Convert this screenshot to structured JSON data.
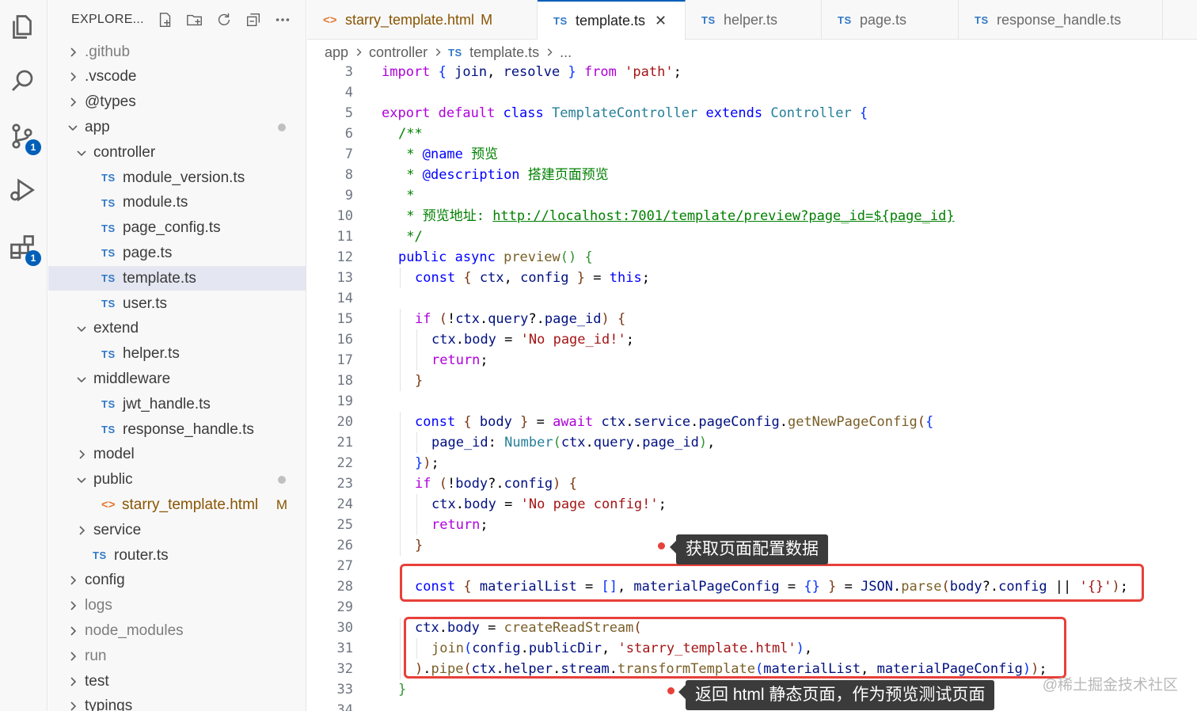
{
  "activity": {
    "scm_badge": "1",
    "extensions_badge": "1"
  },
  "sidebar": {
    "title": "EXPLORE...",
    "tree": [
      {
        "label": ".github",
        "kind": "folder",
        "open": false,
        "depth": 0,
        "dim": true
      },
      {
        "label": ".vscode",
        "kind": "folder",
        "open": false,
        "depth": 0
      },
      {
        "label": "@types",
        "kind": "folder",
        "open": false,
        "depth": 0
      },
      {
        "label": "app",
        "kind": "folder",
        "open": true,
        "depth": 0,
        "git": "modified-dot"
      },
      {
        "label": "controller",
        "kind": "folder",
        "open": true,
        "depth": 1
      },
      {
        "label": "module_version.ts",
        "kind": "ts",
        "depth": 2
      },
      {
        "label": "module.ts",
        "kind": "ts",
        "depth": 2
      },
      {
        "label": "page_config.ts",
        "kind": "ts",
        "depth": 2
      },
      {
        "label": "page.ts",
        "kind": "ts",
        "depth": 2
      },
      {
        "label": "template.ts",
        "kind": "ts",
        "depth": 2,
        "selected": true
      },
      {
        "label": "user.ts",
        "kind": "ts",
        "depth": 2
      },
      {
        "label": "extend",
        "kind": "folder",
        "open": true,
        "depth": 1
      },
      {
        "label": "helper.ts",
        "kind": "ts",
        "depth": 2
      },
      {
        "label": "middleware",
        "kind": "folder",
        "open": true,
        "depth": 1
      },
      {
        "label": "jwt_handle.ts",
        "kind": "ts",
        "depth": 2
      },
      {
        "label": "response_handle.ts",
        "kind": "ts",
        "depth": 2
      },
      {
        "label": "model",
        "kind": "folder",
        "open": false,
        "depth": 1
      },
      {
        "label": "public",
        "kind": "folder",
        "open": true,
        "depth": 1,
        "git": "modified-dot"
      },
      {
        "label": "starry_template.html",
        "kind": "html",
        "depth": 2,
        "git": "M"
      },
      {
        "label": "service",
        "kind": "folder",
        "open": false,
        "depth": 1
      },
      {
        "label": "router.ts",
        "kind": "ts",
        "depth": 1
      },
      {
        "label": "config",
        "kind": "folder",
        "open": false,
        "depth": 0
      },
      {
        "label": "logs",
        "kind": "folder",
        "open": false,
        "depth": 0,
        "dim": true
      },
      {
        "label": "node_modules",
        "kind": "folder",
        "open": false,
        "depth": 0,
        "dim": true
      },
      {
        "label": "run",
        "kind": "folder",
        "open": false,
        "depth": 0,
        "dim": true
      },
      {
        "label": "test",
        "kind": "folder",
        "open": false,
        "depth": 0
      },
      {
        "label": "typings",
        "kind": "folder",
        "open": false,
        "depth": 0
      }
    ]
  },
  "tabs": [
    {
      "label": "starry_template.html",
      "kind": "html",
      "flag": "M",
      "active": false
    },
    {
      "label": "template.ts",
      "kind": "ts",
      "active": true,
      "close": "✕"
    },
    {
      "label": "helper.ts",
      "kind": "ts",
      "active": false
    },
    {
      "label": "page.ts",
      "kind": "ts",
      "active": false
    },
    {
      "label": "response_handle.ts",
      "kind": "ts",
      "active": false
    }
  ],
  "file_icons": {
    "ts": "TS",
    "html": "<>"
  },
  "breadcrumb": [
    "app",
    "controller",
    "template.ts",
    "..."
  ],
  "code_lines": [
    {
      "n": "3",
      "indent": 0,
      "tokens": [
        [
          "kc",
          "import "
        ],
        [
          "br1",
          "{ "
        ],
        [
          "var",
          "join"
        ],
        [
          "pl",
          ", "
        ],
        [
          "var",
          "resolve"
        ],
        [
          "br1",
          " }"
        ],
        [
          "kc",
          " from "
        ],
        [
          "str",
          "'path'"
        ],
        [
          "pl",
          ";"
        ]
      ]
    },
    {
      "n": "4",
      "indent": 0,
      "tokens": []
    },
    {
      "n": "5",
      "indent": 0,
      "tokens": [
        [
          "kc",
          "export "
        ],
        [
          "kc",
          "default "
        ],
        [
          "kw",
          "class "
        ],
        [
          "cls",
          "TemplateController "
        ],
        [
          "kw",
          "extends "
        ],
        [
          "cls",
          "Controller "
        ],
        [
          "br1",
          "{"
        ]
      ]
    },
    {
      "n": "6",
      "indent": 1,
      "tokens": [
        [
          "cm",
          "/**"
        ]
      ]
    },
    {
      "n": "7",
      "indent": 1,
      "tokens": [
        [
          "cm",
          " * "
        ],
        [
          "cm-tag",
          "@name"
        ],
        [
          "cm",
          " 预览"
        ]
      ]
    },
    {
      "n": "8",
      "indent": 1,
      "tokens": [
        [
          "cm",
          " * "
        ],
        [
          "cm-tag",
          "@description"
        ],
        [
          "cm",
          " 搭建页面预览"
        ]
      ]
    },
    {
      "n": "9",
      "indent": 1,
      "tokens": [
        [
          "cm",
          " *"
        ]
      ]
    },
    {
      "n": "10",
      "indent": 1,
      "tokens": [
        [
          "cm",
          " * 预览地址: "
        ],
        [
          "lnk",
          "http://localhost:7001/template/preview?page_id=${page_id}"
        ]
      ]
    },
    {
      "n": "11",
      "indent": 1,
      "tokens": [
        [
          "cm",
          " */"
        ]
      ]
    },
    {
      "n": "12",
      "indent": 1,
      "tokens": [
        [
          "kw",
          "public "
        ],
        [
          "kw",
          "async "
        ],
        [
          "fn",
          "preview"
        ],
        [
          "br2",
          "()"
        ],
        [
          "pl",
          " "
        ],
        [
          "br2",
          "{"
        ]
      ]
    },
    {
      "n": "13",
      "indent": 2,
      "tokens": [
        [
          "kw",
          "const "
        ],
        [
          "br3",
          "{ "
        ],
        [
          "var",
          "ctx"
        ],
        [
          "pl",
          ", "
        ],
        [
          "var",
          "config"
        ],
        [
          "br3",
          " }"
        ],
        [
          "pl",
          " = "
        ],
        [
          "kw",
          "this"
        ],
        [
          "pl",
          ";"
        ]
      ]
    },
    {
      "n": "14",
      "indent": 0,
      "tokens": []
    },
    {
      "n": "15",
      "indent": 2,
      "tokens": [
        [
          "kc",
          "if "
        ],
        [
          "br3",
          "("
        ],
        [
          "pl",
          "!"
        ],
        [
          "var",
          "ctx"
        ],
        [
          "pl",
          "."
        ],
        [
          "var",
          "query"
        ],
        [
          "pl",
          "?."
        ],
        [
          "var",
          "page_id"
        ],
        [
          "br3",
          ")"
        ],
        [
          "pl",
          " "
        ],
        [
          "br3",
          "{"
        ]
      ]
    },
    {
      "n": "16",
      "indent": 3,
      "tokens": [
        [
          "var",
          "ctx"
        ],
        [
          "pl",
          "."
        ],
        [
          "var",
          "body"
        ],
        [
          "pl",
          " = "
        ],
        [
          "str",
          "'No page_id!'"
        ],
        [
          "pl",
          ";"
        ]
      ]
    },
    {
      "n": "17",
      "indent": 3,
      "tokens": [
        [
          "kc",
          "return"
        ],
        [
          "pl",
          ";"
        ]
      ]
    },
    {
      "n": "18",
      "indent": 2,
      "tokens": [
        [
          "br3",
          "}"
        ]
      ]
    },
    {
      "n": "19",
      "indent": 0,
      "tokens": []
    },
    {
      "n": "20",
      "indent": 2,
      "tokens": [
        [
          "kw",
          "const "
        ],
        [
          "br3",
          "{ "
        ],
        [
          "var",
          "body"
        ],
        [
          "br3",
          " }"
        ],
        [
          "pl",
          " = "
        ],
        [
          "kc",
          "await "
        ],
        [
          "var",
          "ctx"
        ],
        [
          "pl",
          "."
        ],
        [
          "var",
          "service"
        ],
        [
          "pl",
          "."
        ],
        [
          "var",
          "pageConfig"
        ],
        [
          "pl",
          "."
        ],
        [
          "fn",
          "getNewPageConfig"
        ],
        [
          "br3",
          "("
        ],
        [
          "br1",
          "{"
        ]
      ]
    },
    {
      "n": "21",
      "indent": 3,
      "tokens": [
        [
          "var",
          "page_id"
        ],
        [
          "pl",
          ": "
        ],
        [
          "cls",
          "Number"
        ],
        [
          "br2",
          "("
        ],
        [
          "var",
          "ctx"
        ],
        [
          "pl",
          "."
        ],
        [
          "var",
          "query"
        ],
        [
          "pl",
          "."
        ],
        [
          "var",
          "page_id"
        ],
        [
          "br2",
          ")"
        ],
        [
          "pl",
          ","
        ]
      ]
    },
    {
      "n": "22",
      "indent": 2,
      "tokens": [
        [
          "br1",
          "}"
        ],
        [
          "br3",
          ")"
        ],
        [
          "pl",
          ";"
        ]
      ]
    },
    {
      "n": "23",
      "indent": 2,
      "tokens": [
        [
          "kc",
          "if "
        ],
        [
          "br3",
          "("
        ],
        [
          "pl",
          "!"
        ],
        [
          "var",
          "body"
        ],
        [
          "pl",
          "?."
        ],
        [
          "var",
          "config"
        ],
        [
          "br3",
          ")"
        ],
        [
          "pl",
          " "
        ],
        [
          "br3",
          "{"
        ]
      ]
    },
    {
      "n": "24",
      "indent": 3,
      "tokens": [
        [
          "var",
          "ctx"
        ],
        [
          "pl",
          "."
        ],
        [
          "var",
          "body"
        ],
        [
          "pl",
          " = "
        ],
        [
          "str",
          "'No page config!'"
        ],
        [
          "pl",
          ";"
        ]
      ]
    },
    {
      "n": "25",
      "indent": 3,
      "tokens": [
        [
          "kc",
          "return"
        ],
        [
          "pl",
          ";"
        ]
      ]
    },
    {
      "n": "26",
      "indent": 2,
      "tokens": [
        [
          "br3",
          "}"
        ]
      ]
    },
    {
      "n": "27",
      "indent": 0,
      "tokens": []
    },
    {
      "n": "28",
      "indent": 2,
      "tokens": [
        [
          "kw",
          "const "
        ],
        [
          "br3",
          "{ "
        ],
        [
          "var",
          "materialList"
        ],
        [
          "pl",
          " = "
        ],
        [
          "br1",
          "[]"
        ],
        [
          "pl",
          ", "
        ],
        [
          "var",
          "materialPageConfig"
        ],
        [
          "pl",
          " = "
        ],
        [
          "br1",
          "{}"
        ],
        [
          "br3",
          " }"
        ],
        [
          "pl",
          " = "
        ],
        [
          "var",
          "JSON"
        ],
        [
          "pl",
          "."
        ],
        [
          "fn",
          "parse"
        ],
        [
          "br3",
          "("
        ],
        [
          "var",
          "body"
        ],
        [
          "pl",
          "?."
        ],
        [
          "var",
          "config"
        ],
        [
          "pl",
          " || "
        ],
        [
          "str",
          "'{}'"
        ],
        [
          "br3",
          ")"
        ],
        [
          "pl",
          ";"
        ]
      ]
    },
    {
      "n": "29",
      "indent": 0,
      "tokens": []
    },
    {
      "n": "30",
      "indent": 2,
      "tokens": [
        [
          "var",
          "ctx"
        ],
        [
          "pl",
          "."
        ],
        [
          "var",
          "body"
        ],
        [
          "pl",
          " = "
        ],
        [
          "fn",
          "createReadStream"
        ],
        [
          "br3",
          "("
        ]
      ]
    },
    {
      "n": "31",
      "indent": 3,
      "tokens": [
        [
          "fn",
          "join"
        ],
        [
          "br1",
          "("
        ],
        [
          "var",
          "config"
        ],
        [
          "pl",
          "."
        ],
        [
          "var",
          "publicDir"
        ],
        [
          "pl",
          ", "
        ],
        [
          "str",
          "'starry_template.html'"
        ],
        [
          "br1",
          ")"
        ],
        [
          "pl",
          ","
        ]
      ]
    },
    {
      "n": "32",
      "indent": 2,
      "tokens": [
        [
          "br3",
          ")"
        ],
        [
          "pl",
          "."
        ],
        [
          "fn",
          "pipe"
        ],
        [
          "br3",
          "("
        ],
        [
          "var",
          "ctx"
        ],
        [
          "pl",
          "."
        ],
        [
          "var",
          "helper"
        ],
        [
          "pl",
          "."
        ],
        [
          "var",
          "stream"
        ],
        [
          "pl",
          "."
        ],
        [
          "fn",
          "transformTemplate"
        ],
        [
          "br1",
          "("
        ],
        [
          "var",
          "materialList"
        ],
        [
          "pl",
          ", "
        ],
        [
          "var",
          "materialPageConfig"
        ],
        [
          "br1",
          ")"
        ],
        [
          "br3",
          ")"
        ],
        [
          "pl",
          ";"
        ]
      ]
    },
    {
      "n": "33",
      "indent": 1,
      "tokens": [
        [
          "br2",
          "}"
        ]
      ]
    },
    {
      "n": "34",
      "indent": 0,
      "tokens": []
    }
  ],
  "annotations": {
    "callout_1": "获取页面配置数据",
    "callout_2": "返回 html 静态页面，作为预览测试页面"
  },
  "watermark": "@稀土掘金技术社区"
}
